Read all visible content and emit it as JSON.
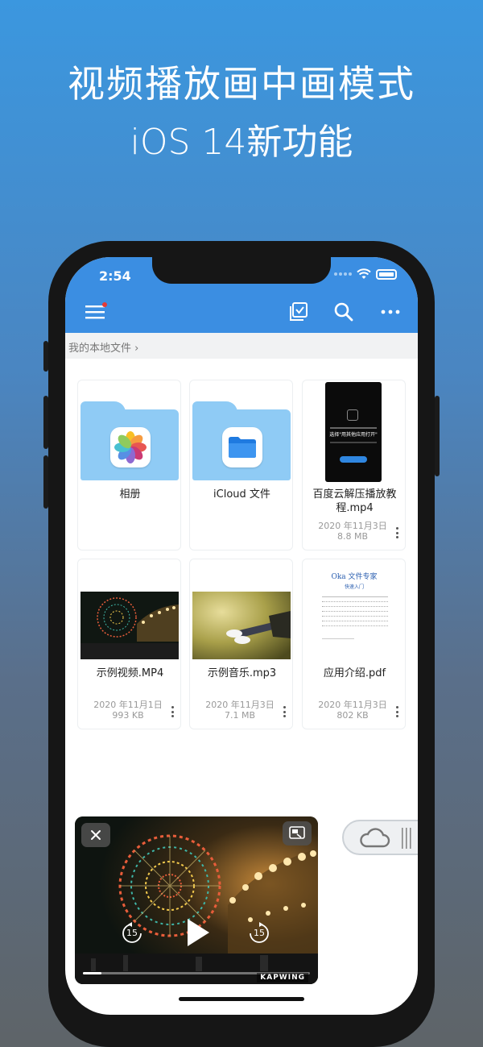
{
  "promo": {
    "headline_line1": "视频播放画中画模式",
    "headline_line2": "iOS 14新功能"
  },
  "status_bar": {
    "time": "2:54"
  },
  "toolbar": {
    "menu_icon": "hamburger-menu-icon",
    "select_icon": "multi-select-icon",
    "search_icon": "search-icon",
    "more_icon": "ellipsis-icon"
  },
  "breadcrumb": {
    "path": "我的本地文件 ›"
  },
  "files": [
    {
      "name": "相册",
      "type": "folder",
      "icon": "photos-app-icon"
    },
    {
      "name": "iCloud 文件",
      "type": "folder",
      "icon": "files-app-icon"
    },
    {
      "name": "百度云解压播放教程.mp4",
      "date": "2020 年11月3日",
      "size": "8.8 MB",
      "type": "video"
    },
    {
      "name": "示例视频.MP4",
      "date": "2020 年11月1日",
      "size": "993 KB",
      "type": "video"
    },
    {
      "name": "示例音乐.mp3",
      "date": "2020 年11月3日",
      "size": "7.1 MB",
      "type": "audio"
    },
    {
      "name": "应用介绍.pdf",
      "date": "2020 年11月3日",
      "size": "802 KB",
      "type": "pdf"
    }
  ],
  "thumb_doc": {
    "title": "Oka 文件专家",
    "subtitle": "快速入门",
    "phone_text": "选择\"用其他应用打开\""
  },
  "pip_player": {
    "skip_back": "15",
    "skip_forward": "15",
    "watermark": "KAPWING",
    "progress": 0.08
  },
  "colors": {
    "accent": "#3b8ee2",
    "folder": "#8fcbf5"
  }
}
